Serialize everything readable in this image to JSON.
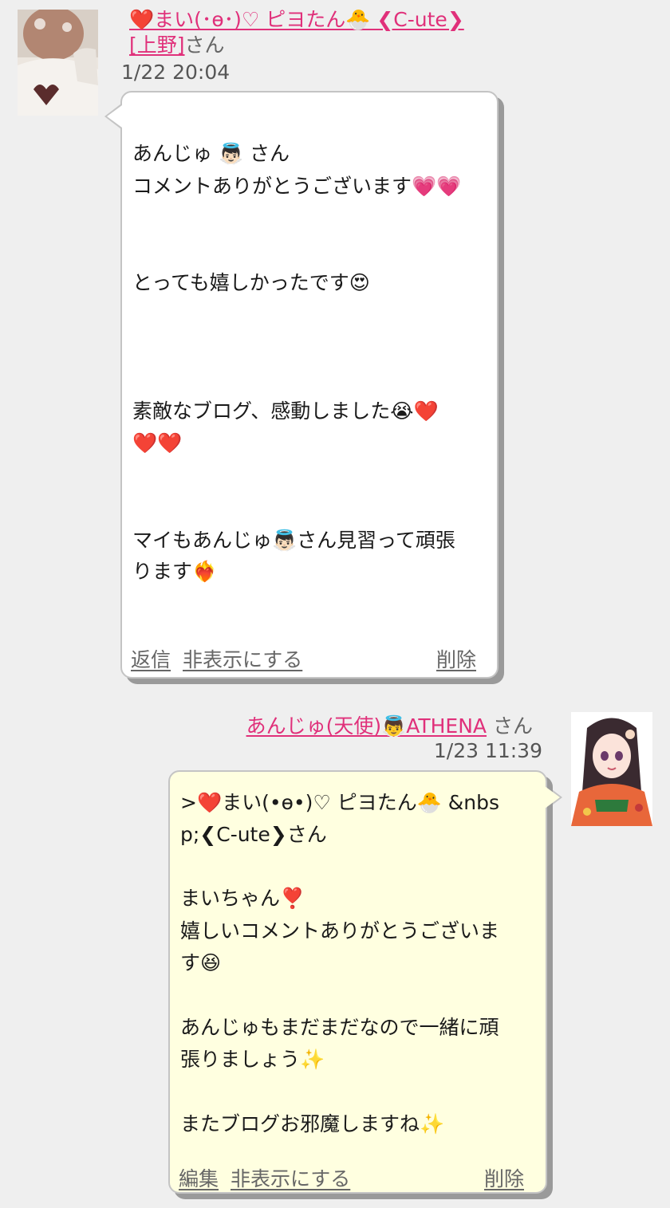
{
  "comments": [
    {
      "author_name": "❤️まい(･ө･)♡ ピヨたん🐣 ❮C-ute❯",
      "author_location": "[上野]",
      "author_suffix": "さん",
      "timestamp": "1/22 20:04",
      "lines": [
        "あんじゅ 👼🏻 さん",
        "コメントありがとうございます💗💗",
        "とっても嬉しかったです😍",
        "素敵なブログ、感動しました😭❤️",
        "❤️❤️",
        "マイもあんじゅ👼🏻さん見習って頑張",
        "ります❤️‍🔥"
      ],
      "actions": {
        "reply": "返信",
        "hide": "非表示にする",
        "delete": "削除"
      }
    },
    {
      "author_name": "あんじゅ(天使)👼ATHENA",
      "author_suffix": "さん",
      "timestamp": "1/23 11:39",
      "lines": [
        ">❤️まい(•ө•)♡ ピヨたん🐣 &nbs",
        "p;❮C-ute❯さん",
        "まいちゃん❣️",
        "嬉しいコメントありがとうございま",
        "す😆",
        "あんじゅもまだまだなので一緒に頑",
        "張りましょう✨",
        "またブログお邪魔しますね✨"
      ],
      "actions": {
        "edit": "編集",
        "hide": "非表示にする",
        "delete": "削除"
      }
    }
  ]
}
